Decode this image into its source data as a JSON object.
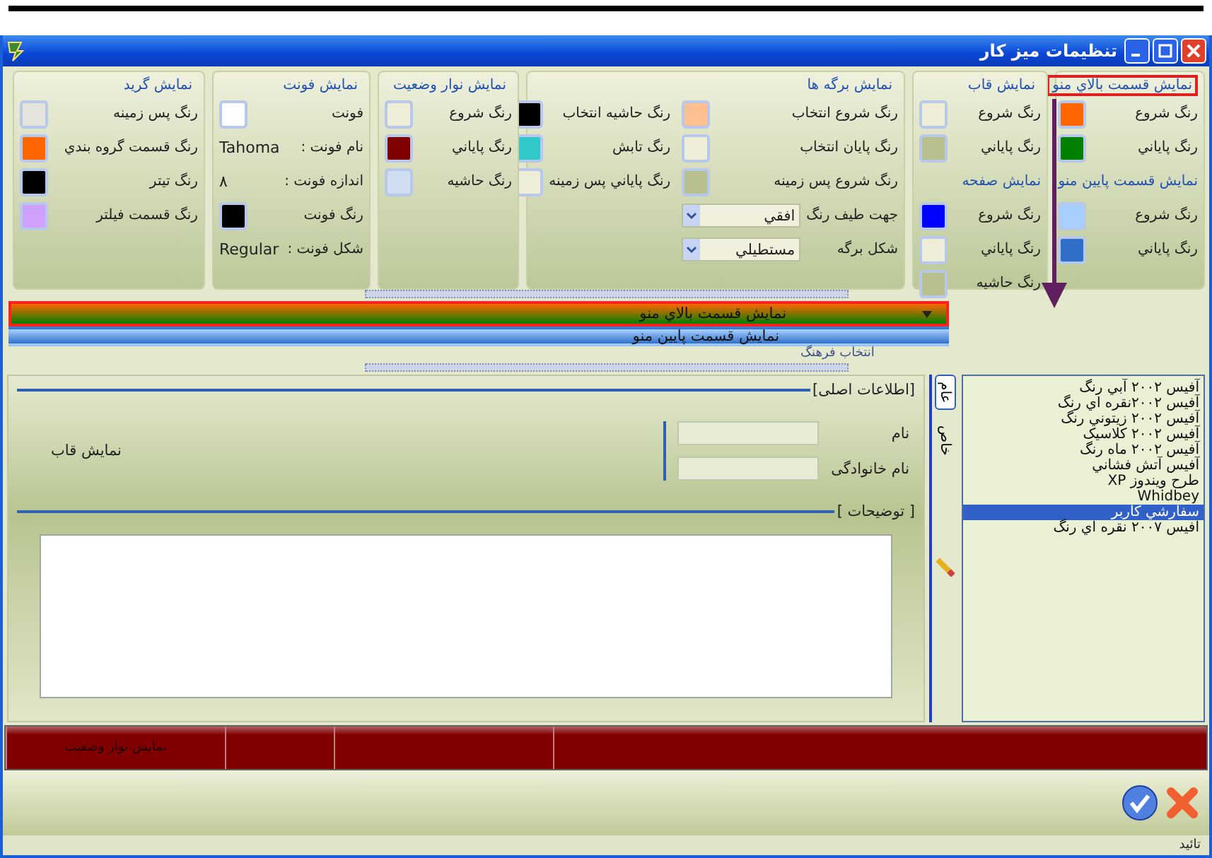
{
  "window": {
    "title": "تنظیمات میز کار"
  },
  "top_panel": {
    "groups": [
      {
        "title": "نمایش قسمت بالاي منو",
        "highlighted": true,
        "columns": [
          [
            {
              "kind": "swatch",
              "label": "رنگ شروع",
              "color": "#ff6600"
            },
            {
              "kind": "swatch",
              "label": "رنگ پاياني",
              "color": "#008000"
            },
            {
              "kind": "heading",
              "label": "نمايش قسمت پايين منو"
            },
            {
              "kind": "swatch",
              "label": "رنگ شروع",
              "color": "#a8d0ff"
            },
            {
              "kind": "swatch",
              "label": "رنگ پاياني",
              "color": "#3070c8"
            }
          ]
        ]
      },
      {
        "title": "نمايش قاب",
        "highlighted": false,
        "columns": [
          [
            {
              "kind": "swatch",
              "label": "رنگ شروع",
              "color": "#eeeed8"
            },
            {
              "kind": "swatch",
              "label": "رنگ پاياني",
              "color": "#b8c090"
            },
            {
              "kind": "heading",
              "label": "نمايش صفحه"
            },
            {
              "kind": "swatch",
              "label": "رنگ شروع",
              "color": "#0000ff"
            },
            {
              "kind": "swatch",
              "label": "رنگ پاياني",
              "color": "#eeeed8"
            },
            {
              "kind": "swatch",
              "label": "رنگ حاشيه",
              "color": "#b8c090"
            }
          ]
        ]
      },
      {
        "title": "نمايش برگه ها",
        "highlighted": false,
        "columns": [
          [
            {
              "kind": "swatch",
              "label": "رنگ شروع انتخاب",
              "color": "#ffc090"
            },
            {
              "kind": "swatch",
              "label": "رنگ پايان انتخاب",
              "color": "#eeeed8"
            },
            {
              "kind": "swatch",
              "label": "رنگ شروع پس زمينه",
              "color": "#b8c090"
            },
            {
              "kind": "dropdown",
              "label": "جهت  طيف رنگ",
              "value": "افقي"
            },
            {
              "kind": "dropdown",
              "label": "شکل برگه",
              "value": "مستطيلي"
            }
          ],
          [
            {
              "kind": "swatch",
              "label": "رنگ حاشيه انتخاب",
              "color": "#000000"
            },
            {
              "kind": "swatch",
              "label": "رنگ تابش",
              "color": "#30c8c8"
            },
            {
              "kind": "swatch",
              "label": "رنگ پاياني پس زمينه",
              "color": "#eeeed8"
            }
          ]
        ]
      },
      {
        "title": "نمايش نوار وضعيت",
        "highlighted": false,
        "columns": [
          [
            {
              "kind": "swatch",
              "label": "رنگ شروع",
              "color": "#eeeed8"
            },
            {
              "kind": "swatch",
              "label": "رنگ پاياني",
              "color": "#800000"
            },
            {
              "kind": "swatch",
              "label": "رنگ حاشيه",
              "color": "#d0dcf0"
            }
          ]
        ]
      },
      {
        "title": "نمايش فونت",
        "highlighted": false,
        "columns": [
          [
            {
              "kind": "swatch",
              "label": "فونت",
              "color": "#ffffff"
            },
            {
              "kind": "value",
              "label": "نام فونت :",
              "value": "Tahoma"
            },
            {
              "kind": "value",
              "label": "اندازه فونت :",
              "value": "٨"
            },
            {
              "kind": "swatch",
              "label": "رنگ فونت",
              "color": "#000000"
            },
            {
              "kind": "value",
              "label": "شکل فونت :",
              "value": "Regular"
            }
          ]
        ]
      },
      {
        "title": "نمايش گريد",
        "highlighted": false,
        "columns": [
          [
            {
              "kind": "swatch",
              "label": "رنگ پس زمينه",
              "color": "#e4e4dc"
            },
            {
              "kind": "swatch",
              "label": "رنگ قسمت گروه بندي",
              "color": "#ff6600"
            },
            {
              "kind": "swatch",
              "label": "رنگ تيتر",
              "color": "#000000"
            },
            {
              "kind": "swatch",
              "label": "رنگ قسمت فيلتر",
              "color": "#d0a0ff"
            }
          ]
        ]
      }
    ]
  },
  "preview": {
    "culture_label": "انتخاب فرهنگ",
    "bars": [
      {
        "kind": "top",
        "text": "نمايش قسمت بالاي منو",
        "highlighted": true
      },
      {
        "kind": "bottom",
        "text": "نمايش قسمت پايين منو",
        "highlighted": false
      }
    ]
  },
  "themes": [
    {
      "label": "آفيس ۲۰۰۲ آبي رنگ",
      "selected": false
    },
    {
      "label": "آفيس ۲۰۰۲نقره اي رنگ",
      "selected": false
    },
    {
      "label": "آفيس ۲۰۰۲ زيتوني رنگ",
      "selected": false
    },
    {
      "label": "آفيس ۲۰۰۲ کلاسيک",
      "selected": false
    },
    {
      "label": "آفيس ۲۰۰۲ ماه رنگ",
      "selected": false
    },
    {
      "label": "آفيس آتش فشاني",
      "selected": false
    },
    {
      "label": "طرح ويندوز XP",
      "selected": false
    },
    {
      "label": "Whidbey",
      "selected": false
    },
    {
      "label": "سفارشي کاربر",
      "selected": true
    },
    {
      "label": "افيس ۲۰۰۷ نقره اي رنگ",
      "selected": false
    }
  ],
  "side_tabs": [
    {
      "label": "عام",
      "selected": true
    },
    {
      "label": "خاص",
      "selected": false
    }
  ],
  "details": {
    "main_legend": "[اطلاعات اصلی]",
    "fields": [
      {
        "label": "نام"
      },
      {
        "label": "نام خانوادگی"
      }
    ],
    "frame_text": "نمايش  قاب",
    "notes_legend": "[ توضيحات ]"
  },
  "status_bar": {
    "text": "نمايش نوار وضعيت"
  },
  "footer": {
    "label": "تائيد"
  }
}
